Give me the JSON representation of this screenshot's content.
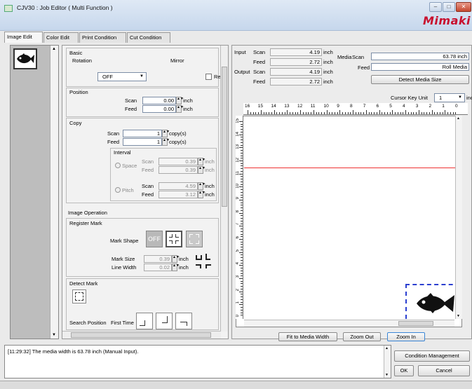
{
  "window": {
    "title": "CJV30 : Job Editor ( Multi Function )",
    "brand": "Mimaki",
    "buttons": [
      "–",
      "□",
      "✕"
    ]
  },
  "tabs": [
    {
      "label": "Image Edit",
      "active": true
    },
    {
      "label": "Color Edit",
      "active": false
    },
    {
      "label": "Print Condition",
      "active": false
    },
    {
      "label": "Cut Condition",
      "active": false
    }
  ],
  "thumbnails": [
    {
      "icon": "fish-icon",
      "selected": true
    }
  ],
  "basic": {
    "title": "Basic",
    "rotation_label": "Rotation",
    "rotation_value": "OFF",
    "mirror_label": "Mirror",
    "reverse_label": "Rev",
    "reverse_checked": false
  },
  "position": {
    "title": "Position",
    "scan_label": "Scan",
    "scan_value": "0.00",
    "feed_label": "Feed",
    "feed_value": "0.00",
    "unit": "inch"
  },
  "copy": {
    "title": "Copy",
    "scan_label": "Scan",
    "scan_value": "1",
    "feed_label": "Feed",
    "feed_value": "1",
    "unit": "copy(s)",
    "interval_label": "Interval",
    "space_label": "Space",
    "space_scan_label": "Scan",
    "space_scan_value": "0.39",
    "space_feed_label": "Feed",
    "space_feed_value": "0.39",
    "pitch_label": "Pitch",
    "pitch_scan_label": "Scan",
    "pitch_scan_value": "4.59",
    "pitch_feed_label": "Feed",
    "pitch_feed_value": "3.12",
    "interval_unit": "inch"
  },
  "image_operation": {
    "title": "Image Operation",
    "register_mark_label": "Register Mark",
    "mark_shape_label": "Mark Shape",
    "mark_shape_off": "OFF",
    "mark_size_label": "Mark Size",
    "mark_size_value": "0.39",
    "line_width_label": "Line Width",
    "line_width_value": "0.02",
    "unit": "inch",
    "detect_mark_label": "Detect Mark",
    "search_position_label": "Search Position",
    "first_time_label": "First Time"
  },
  "size_info": {
    "input_label": "Input",
    "output_label": "Output",
    "scan_label": "Scan",
    "feed_label": "Feed",
    "input_scan": "4.19",
    "input_feed": "2.72",
    "output_scan": "4.19",
    "output_feed": "2.72",
    "unit": "inch"
  },
  "media": {
    "label": "Media",
    "scan_label": "Scan",
    "scan_value": "63.78 inch",
    "feed_label": "Feed",
    "feed_value": "Roll Media",
    "detect_button": "Detect Media Size",
    "cursor_key_label": "Cursor Key Unit",
    "cursor_key_value": "1",
    "cursor_key_unit": "inch"
  },
  "ruler_h_ticks": [
    "16",
    "15",
    "14",
    "13",
    "12",
    "11",
    "10",
    "9",
    "8",
    "7",
    "6",
    "5",
    "4",
    "3",
    "2",
    "1",
    "0"
  ],
  "ruler_v_ticks": [
    "15",
    "14",
    "13",
    "12",
    "11",
    "10",
    "9",
    "8",
    "7",
    "6",
    "5",
    "4",
    "3",
    "2",
    "1",
    "0"
  ],
  "canvas_buttons": {
    "fit": "Fit to Media Width",
    "zoom_out": "Zoom Out",
    "zoom_in": "Zoom In"
  },
  "message": "[11:29:32] The media width is 63.78 inch (Manual Input).",
  "dialog_buttons": {
    "condition_management": "Condition Management",
    "ok": "OK",
    "cancel": "Cancel"
  }
}
